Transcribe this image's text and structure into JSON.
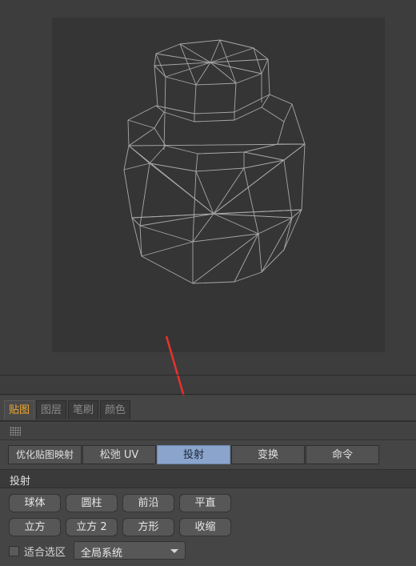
{
  "tabs": [
    {
      "label": "贴图",
      "active": true
    },
    {
      "label": "图层",
      "active": false
    },
    {
      "label": "笔刷",
      "active": false
    },
    {
      "label": "颜色",
      "active": false
    }
  ],
  "modes": [
    {
      "label": "优化贴图映射",
      "active": false
    },
    {
      "label": "松弛 UV",
      "active": false
    },
    {
      "label": "投射",
      "active": true
    },
    {
      "label": "变换",
      "active": false
    },
    {
      "label": "命令",
      "active": false
    }
  ],
  "section": {
    "title": "投射"
  },
  "projection_buttons": {
    "sphere": "球体",
    "cylinder": "圆柱",
    "frontal": "前沿",
    "flat": "平直",
    "cubic": "立方",
    "cubic2": "立方 2",
    "box": "方形",
    "shrink": "收缩"
  },
  "fit_selection": {
    "label": "适合选区",
    "checked": false
  },
  "coordinate_select": {
    "value": "全局系统"
  },
  "colors": {
    "active_tab": "#f0a830",
    "active_mode": "#8aa4cc",
    "annotation_arrow": "#e8322c"
  }
}
